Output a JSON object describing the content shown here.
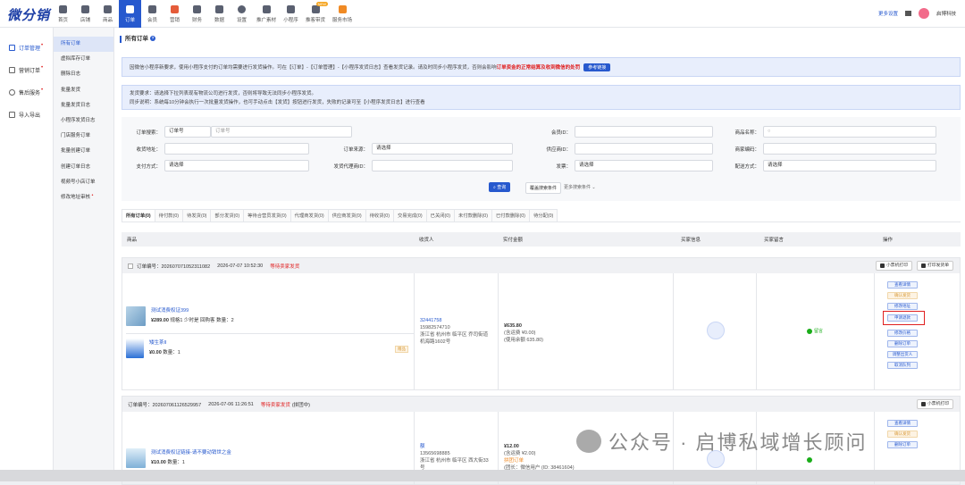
{
  "logo": "微分销",
  "topnav": [
    {
      "label": "首页",
      "icon": "home-icon"
    },
    {
      "label": "店铺",
      "icon": "store-icon"
    },
    {
      "label": "商品",
      "icon": "goods-icon"
    },
    {
      "label": "订单",
      "icon": "order-icon",
      "active": true
    },
    {
      "label": "会员",
      "icon": "member-icon"
    },
    {
      "label": "营销",
      "icon": "marketing-icon"
    },
    {
      "label": "财务",
      "icon": "finance-icon"
    },
    {
      "label": "数据",
      "icon": "data-icon"
    },
    {
      "label": "设置",
      "icon": "settings-icon"
    },
    {
      "label": "推广素材",
      "icon": "share-icon"
    },
    {
      "label": "小程序",
      "icon": "miniapp-icon"
    },
    {
      "label": "推客带货",
      "icon": "promoter-icon",
      "badge": "NEW"
    },
    {
      "label": "服务市场",
      "icon": "service-icon"
    }
  ],
  "topright": {
    "more": "更多设置",
    "user": "启博科技"
  },
  "sidebar1": [
    {
      "label": "订单管理",
      "active": true,
      "dot": true
    },
    {
      "label": "营销订单",
      "dot": true
    },
    {
      "label": "售后服务",
      "dot": true
    },
    {
      "label": "导入导出"
    }
  ],
  "sidebar2": [
    {
      "label": "所有订单",
      "active": true
    },
    {
      "label": "虚拟库存订单"
    },
    {
      "label": "删除日志"
    },
    {
      "label": "批量发货"
    },
    {
      "label": "批量发货日志"
    },
    {
      "label": "小程序发货日志"
    },
    {
      "label": "门店服务订单"
    },
    {
      "label": "批量创建订单"
    },
    {
      "label": "创建订单日志"
    },
    {
      "label": "视频号小店订单"
    },
    {
      "label": "修改地址审核",
      "dot": true
    }
  ],
  "page_title": "所有订单",
  "notice1": {
    "text": "因微信小程序新要求，使用小程序支付的订单均需要进行发货操作。可在【订单】-【订单管理】-【小程序发货日志】查看发货记录。请及时同步小程序发货，否则会影响",
    "red": "订单资金的正常结算及收到微信的处罚",
    "btn": "参考链接"
  },
  "notice2": {
    "line1": "发货要求：请选择下拉列表现有物流公司进行发货，否则将导致无法同步小程序发货。",
    "line2": "同步说明：系统每10分钟会执行一次批量发货操作，也可手动点击【发货】按钮进行发货，失败的记录可至【小程序发货日志】进行查看"
  },
  "search": {
    "order_search_label": "订单搜索：",
    "order_type": "订单号",
    "order_placeholder": "订单号",
    "member_label": "会员ID：",
    "goods_label": "商品名称：",
    "address_label": "收货地址：",
    "source_label": "订单来源：",
    "source_value": "请选择",
    "supplier_label": "供应商ID：",
    "goods_code_label": "商家编码：",
    "pay_label": "支付方式：",
    "pay_value": "请选择",
    "agent_label": "发货代理商ID：",
    "invoice_label": "发票：",
    "invoice_value": "请选择",
    "delivery_label": "配送方式：",
    "delivery_value": "请选择",
    "btn_search": "查询",
    "btn_export": "覆盖搜索条件",
    "btn_more": "更多搜索条件"
  },
  "tabs": [
    "所有订单(0)",
    "待付款(0)",
    "待发货(0)",
    "部分发货(0)",
    "等待合营员发货(0)",
    "代理商发货(0)",
    "供应商发货(0)",
    "待收货(0)",
    "交易完成(0)",
    "已关闭(0)",
    "未付款删除(0)",
    "已付款删除(0)",
    "待分配(0)"
  ],
  "thead": {
    "goods": "商品",
    "receiver": "收货人",
    "paid": "实付金额",
    "buyer": "买家信息",
    "msg": "买家留言",
    "op": "操作"
  },
  "order1": {
    "no": "订单编号：202607071052311082",
    "time": "2026-07-07 10:52:30",
    "status": "等待卖家发货",
    "btn_print_small": "小票机打印",
    "btn_print_express": "打印发货单",
    "p1_name": "测试消费权证399",
    "p1_price": "¥289.00",
    "p1_spec": "规格1 少时是 回购客",
    "p1_qty": "数量：2",
    "p2_name": "矮生茶II",
    "p2_price": "¥0.00",
    "p2_qty": "数量：1",
    "p2_tag": "赠品",
    "receiver_id": "32441758",
    "phone": "15982574710",
    "addr1": "浙江省 杭州市 临平区 乔司街道",
    "addr2": "机海路1602号",
    "amount": "¥635.80",
    "freight": "(含运费 ¥0.00)",
    "balance": "(使用余额 635.80)",
    "msg": "留言",
    "actions": [
      "查看详情",
      "确认发货",
      "修改地址",
      "申请退款",
      "修改价格",
      "删除订单",
      "调整出货人",
      "取消队列"
    ]
  },
  "order2": {
    "no": "订单编号：202607061126529957",
    "time": "2026-07-06 11:26:51",
    "status": "等待卖家发货",
    "extra": "(拼团中)",
    "btn_print_small": "小票机打印",
    "p1_name": "测试消费权证链接-请不要动销世之金",
    "p1_price": "¥10.00",
    "p1_qty": "数量：1",
    "receiver_id": "额",
    "phone": "13565698885",
    "addr1": "浙江省 杭州市 临平区 西大街33",
    "addr2": "号",
    "amount": "¥12.00",
    "freight": "(含运费 ¥2.00)",
    "tag": "拼团订单",
    "from": "(团长：微信用户 (ID: 38461604)",
    "actions": [
      "查看详情",
      "确认发货",
      "删除订单"
    ]
  },
  "watermark": "公众号 · 启博私域增长顾问"
}
